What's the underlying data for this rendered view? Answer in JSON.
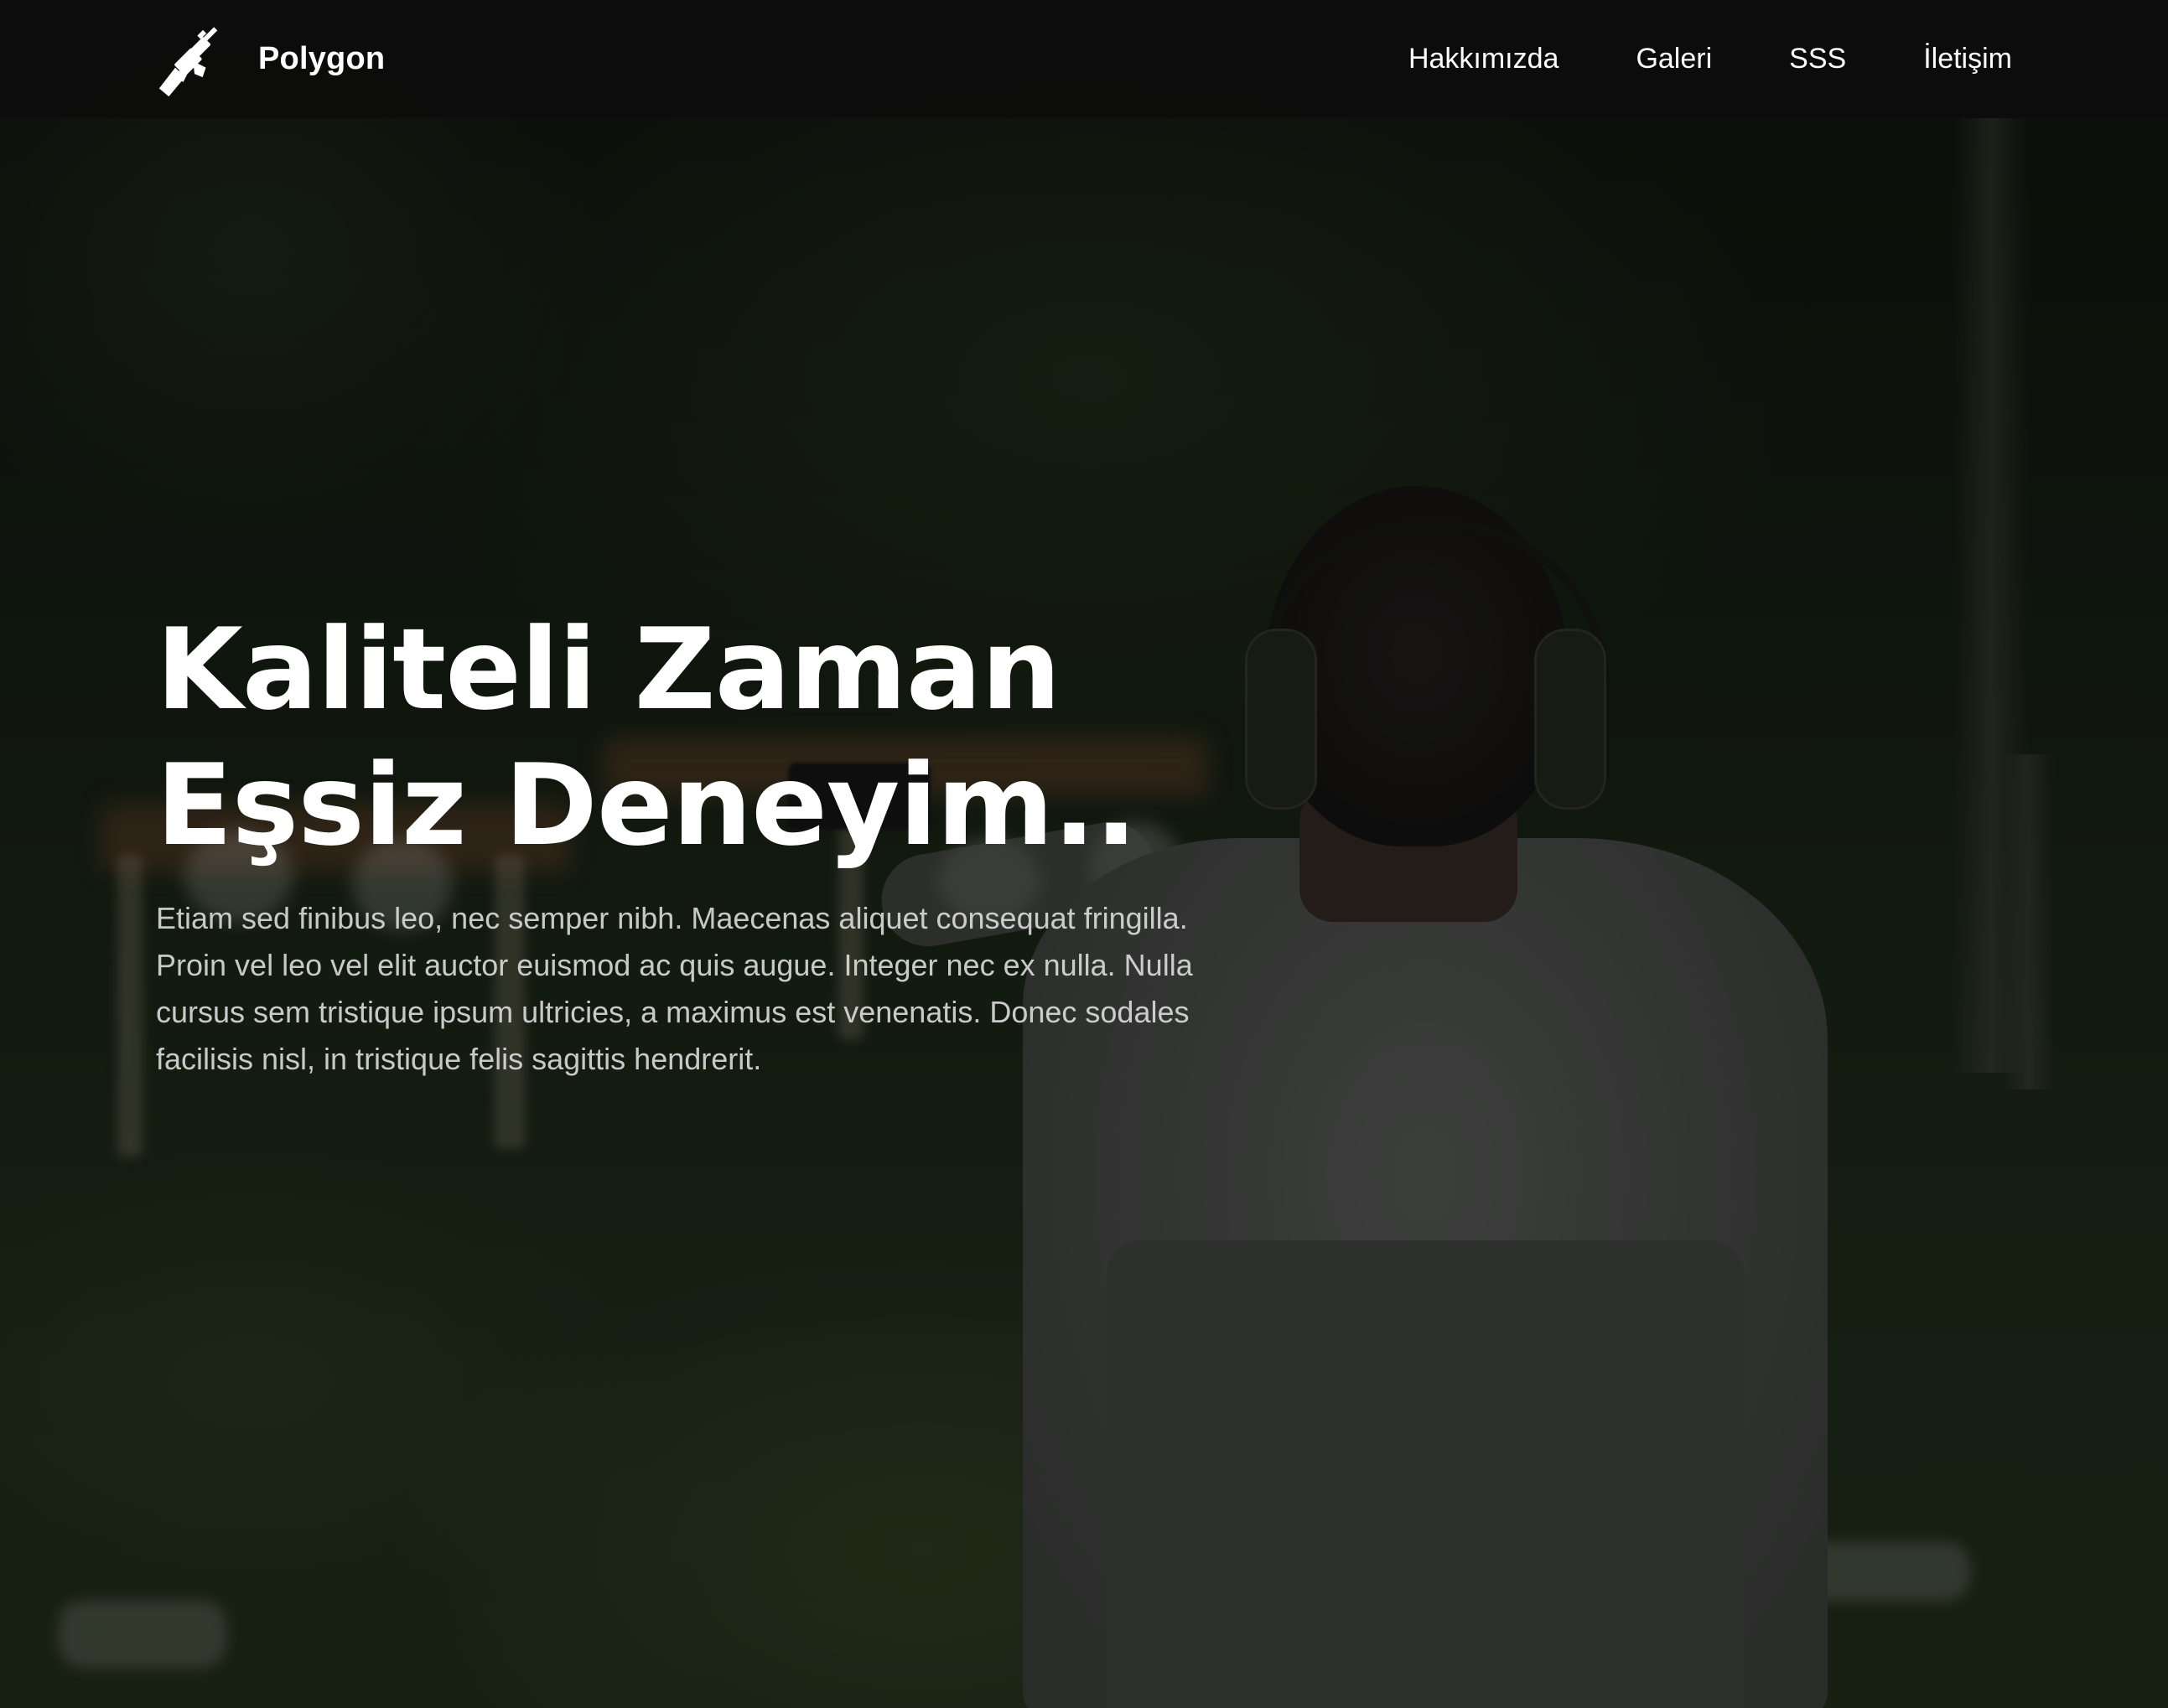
{
  "navbar": {
    "brand_name": "Polygon",
    "brand_icon": "rifle-icon",
    "links": [
      {
        "label": "Hakkımızda"
      },
      {
        "label": "Galeri"
      },
      {
        "label": "SSS"
      },
      {
        "label": "İletişim"
      }
    ]
  },
  "hero": {
    "title_line1": "Kaliteli Zaman",
    "title_line2": "Eşsiz Deneyim..",
    "description": "Etiam sed finibus leo, nec semper nibh. Maecenas aliquet consequat fringilla. Proin vel leo vel elit auctor euismod ac quis augue. Integer nec ex nulla. Nulla cursus sem tristique ipsum ultricies, a maximus est venenatis. Donec sodales facilisis nisl, in tristique felis sagittis hendrerit."
  },
  "colors": {
    "navbar_bg": "#0c0c0c",
    "text_primary": "#ffffff",
    "text_secondary": "#e1e1e1"
  }
}
